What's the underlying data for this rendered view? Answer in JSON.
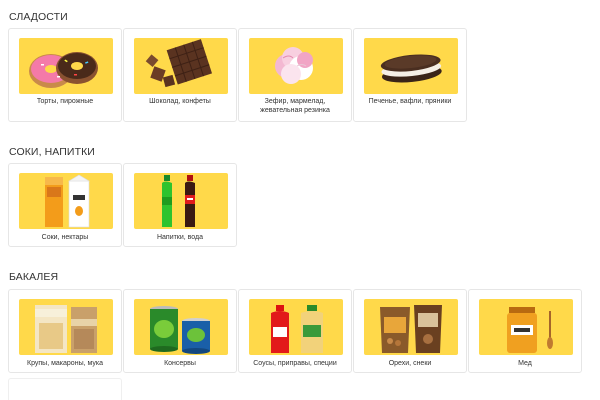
{
  "sections": [
    {
      "title": "СЛАДОСТИ",
      "items": [
        {
          "label": "Торты, пирожные",
          "icon": "donut-icon"
        },
        {
          "label": "Шоколад, конфеты",
          "icon": "chocolate-icon"
        },
        {
          "label": "Зефир, мармелад, жевательная резинка",
          "icon": "marshmallow-icon"
        },
        {
          "label": "Печенье, вафли, пряники",
          "icon": "cookie-icon"
        }
      ]
    },
    {
      "title": "СОКИ, НАПИТКИ",
      "items": [
        {
          "label": "Соки, нектары",
          "icon": "juice-box-icon"
        },
        {
          "label": "Напитки, вода",
          "icon": "soda-bottle-icon"
        }
      ]
    },
    {
      "title": "БАКАЛЕЯ",
      "items": [
        {
          "label": "Крупы, макароны, мука",
          "icon": "pasta-pack-icon"
        },
        {
          "label": "Консервы",
          "icon": "canned-food-icon"
        },
        {
          "label": "Соусы, приправы, специи",
          "icon": "sauce-bottle-icon"
        },
        {
          "label": "Орехи, снеки",
          "icon": "snack-bag-icon"
        },
        {
          "label": "Мед",
          "icon": "honey-jar-icon"
        }
      ]
    }
  ],
  "colors": {
    "thumb_background": "#ffd94a",
    "card_border": "#e6e6e6"
  }
}
